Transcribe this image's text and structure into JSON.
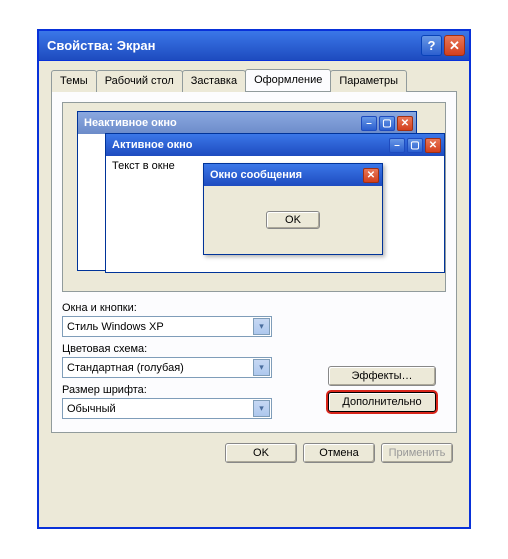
{
  "titlebar": {
    "title": "Свойства: Экран",
    "help": "?",
    "close": "✕"
  },
  "tabs": {
    "themes": "Темы",
    "desktop": "Рабочий стол",
    "screensaver": "Заставка",
    "appearance": "Оформление",
    "settings": "Параметры"
  },
  "preview": {
    "inactive_title": "Неактивное окно",
    "active_title": "Активное окно",
    "sample_text": "Текст в окне",
    "msgbox_title": "Окно сообщения",
    "msgbox_ok": "OK",
    "min": "–",
    "max": "▢",
    "close": "✕"
  },
  "labels": {
    "windows_buttons": "Окна и кнопки:",
    "color_scheme": "Цветовая схема:",
    "font_size": "Размер шрифта:"
  },
  "combos": {
    "style": "Стиль Windows XP",
    "scheme": "Стандартная (голубая)",
    "fontsize": "Обычный",
    "arrow": "▾"
  },
  "buttons": {
    "effects": "Эффекты…",
    "advanced": "Дополнительно",
    "ok": "OK",
    "cancel": "Отмена",
    "apply": "Применить"
  }
}
